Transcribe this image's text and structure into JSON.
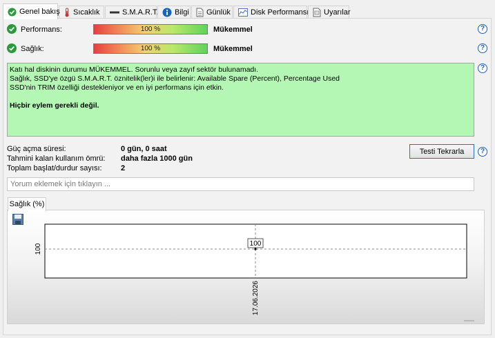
{
  "tabs": [
    {
      "label": "Genel bakış",
      "icon": "check-icon",
      "active": true
    },
    {
      "label": "Sıcaklık",
      "icon": "thermometer-icon",
      "active": false
    },
    {
      "label": "S.M.A.R.T.",
      "icon": "dash-icon",
      "active": false
    },
    {
      "label": "Bilgi",
      "icon": "info-icon",
      "active": false
    },
    {
      "label": "Günlük",
      "icon": "log-icon",
      "active": false
    },
    {
      "label": "Disk Performansı",
      "icon": "performance-chart-icon",
      "active": false
    },
    {
      "label": "Uyarılar",
      "icon": "alerts-icon",
      "active": false
    }
  ],
  "performance": {
    "label": "Performans:",
    "bar_text": "100 %",
    "level_percent": 100,
    "value": "Mükemmel"
  },
  "health": {
    "label": "Sağlık:",
    "bar_text": "100 %",
    "level_percent": 100,
    "value": "Mükemmel"
  },
  "summary": {
    "line1": "Katı hal diskinin durumu MÜKEMMEL. Sorunlu veya zayıf sektör bulunamadı.",
    "line2": "Sağlık, SSD'ye özgü S.M.A.R.T. öznitelik(ler)i ile belirlenir:  Available Spare (Percent), Percentage Used",
    "line3": "SSD'nin TRIM özelliği destekleniyor ve en iyi performans için etkin.",
    "action": "Hiçbir eylem gerekli değil."
  },
  "info": {
    "power_on_label": "Güç açma süresi:",
    "power_on_value": "0 gün, 0 saat",
    "lifetime_label": "Tahmini kalan kullanım ömrü:",
    "lifetime_value": "daha fazla 1000 gün",
    "startstop_label": "Toplam başlat/durdur sayısı:",
    "startstop_value": "2"
  },
  "retest_label": "Testi Tekrarla",
  "comment_placeholder": "Yorum eklemek için tıklayın ...",
  "chart_tab": "Sağlık (%)",
  "colors": {
    "summary_bg": "#b4f7b4",
    "ok_green": "#2a9a3c",
    "help_blue": "#1e5fb4"
  },
  "chart_data": {
    "type": "scatter",
    "x": [
      "17.06.2026"
    ],
    "values": [
      100
    ],
    "ytick_labels": [
      "100"
    ],
    "data_labels": [
      "100"
    ],
    "grid": true
  }
}
